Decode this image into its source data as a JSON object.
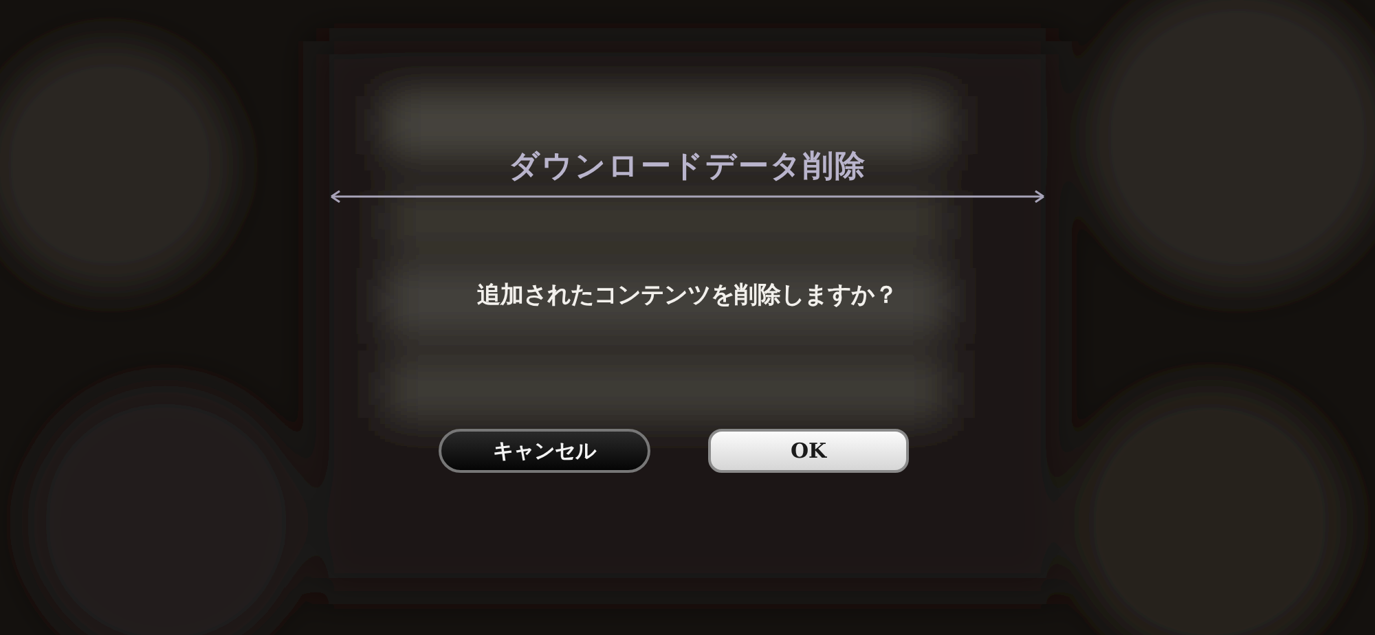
{
  "dialog": {
    "title": "ダウンロードデータ削除",
    "message": "追加されたコンテンツを削除しますか？",
    "buttons": [
      {
        "label": "キャンセル",
        "kind": "secondary"
      },
      {
        "label": "OK",
        "kind": "primary"
      }
    ]
  }
}
